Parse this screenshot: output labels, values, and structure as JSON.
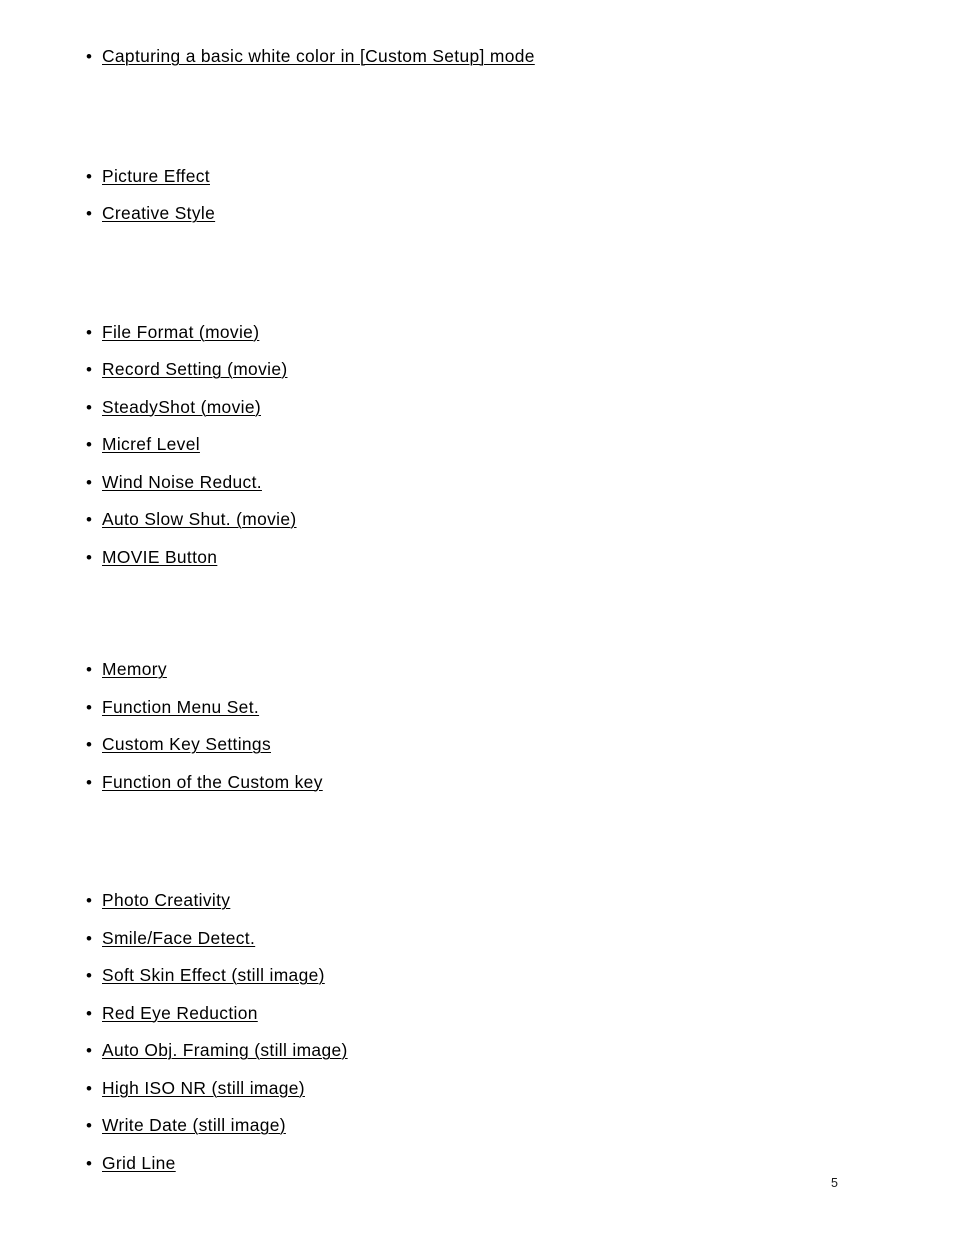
{
  "document": {
    "page_number": "5",
    "bullet_glyph": "•",
    "text_color": "#000000",
    "background_color": "#ffffff"
  },
  "toc": {
    "groups": [
      {
        "group_name": "white-balance-group",
        "items": [
          {
            "label": "Capturing a basic white color in [Custom Setup] mode"
          }
        ]
      },
      {
        "group_name": "picture-style-group",
        "items": [
          {
            "label": "Picture Effect"
          },
          {
            "label": "Creative Style"
          }
        ]
      },
      {
        "group_name": "movie-settings-group",
        "items": [
          {
            "label": "File Format (movie)"
          },
          {
            "label": "Record Setting (movie)"
          },
          {
            "label": "SteadyShot (movie)"
          },
          {
            "label": "Micref Level"
          },
          {
            "label": "Wind Noise Reduct."
          },
          {
            "label": "Auto Slow Shut. (movie)"
          },
          {
            "label": "MOVIE Button"
          }
        ]
      },
      {
        "group_name": "custom-settings-group",
        "items": [
          {
            "label": "Memory"
          },
          {
            "label": "Function Menu Set."
          },
          {
            "label": "Custom Key Settings"
          },
          {
            "label": "Function of the Custom key"
          }
        ]
      },
      {
        "group_name": "still-image-settings-group",
        "items": [
          {
            "label": "Photo Creativity"
          },
          {
            "label": "Smile/Face Detect."
          },
          {
            "label": "Soft Skin Effect (still image)"
          },
          {
            "label": "Red Eye Reduction"
          },
          {
            "label": "Auto Obj. Framing (still image)"
          },
          {
            "label": "High ISO NR (still image)"
          },
          {
            "label": "Write Date (still image)"
          },
          {
            "label": "Grid Line"
          }
        ]
      }
    ]
  }
}
